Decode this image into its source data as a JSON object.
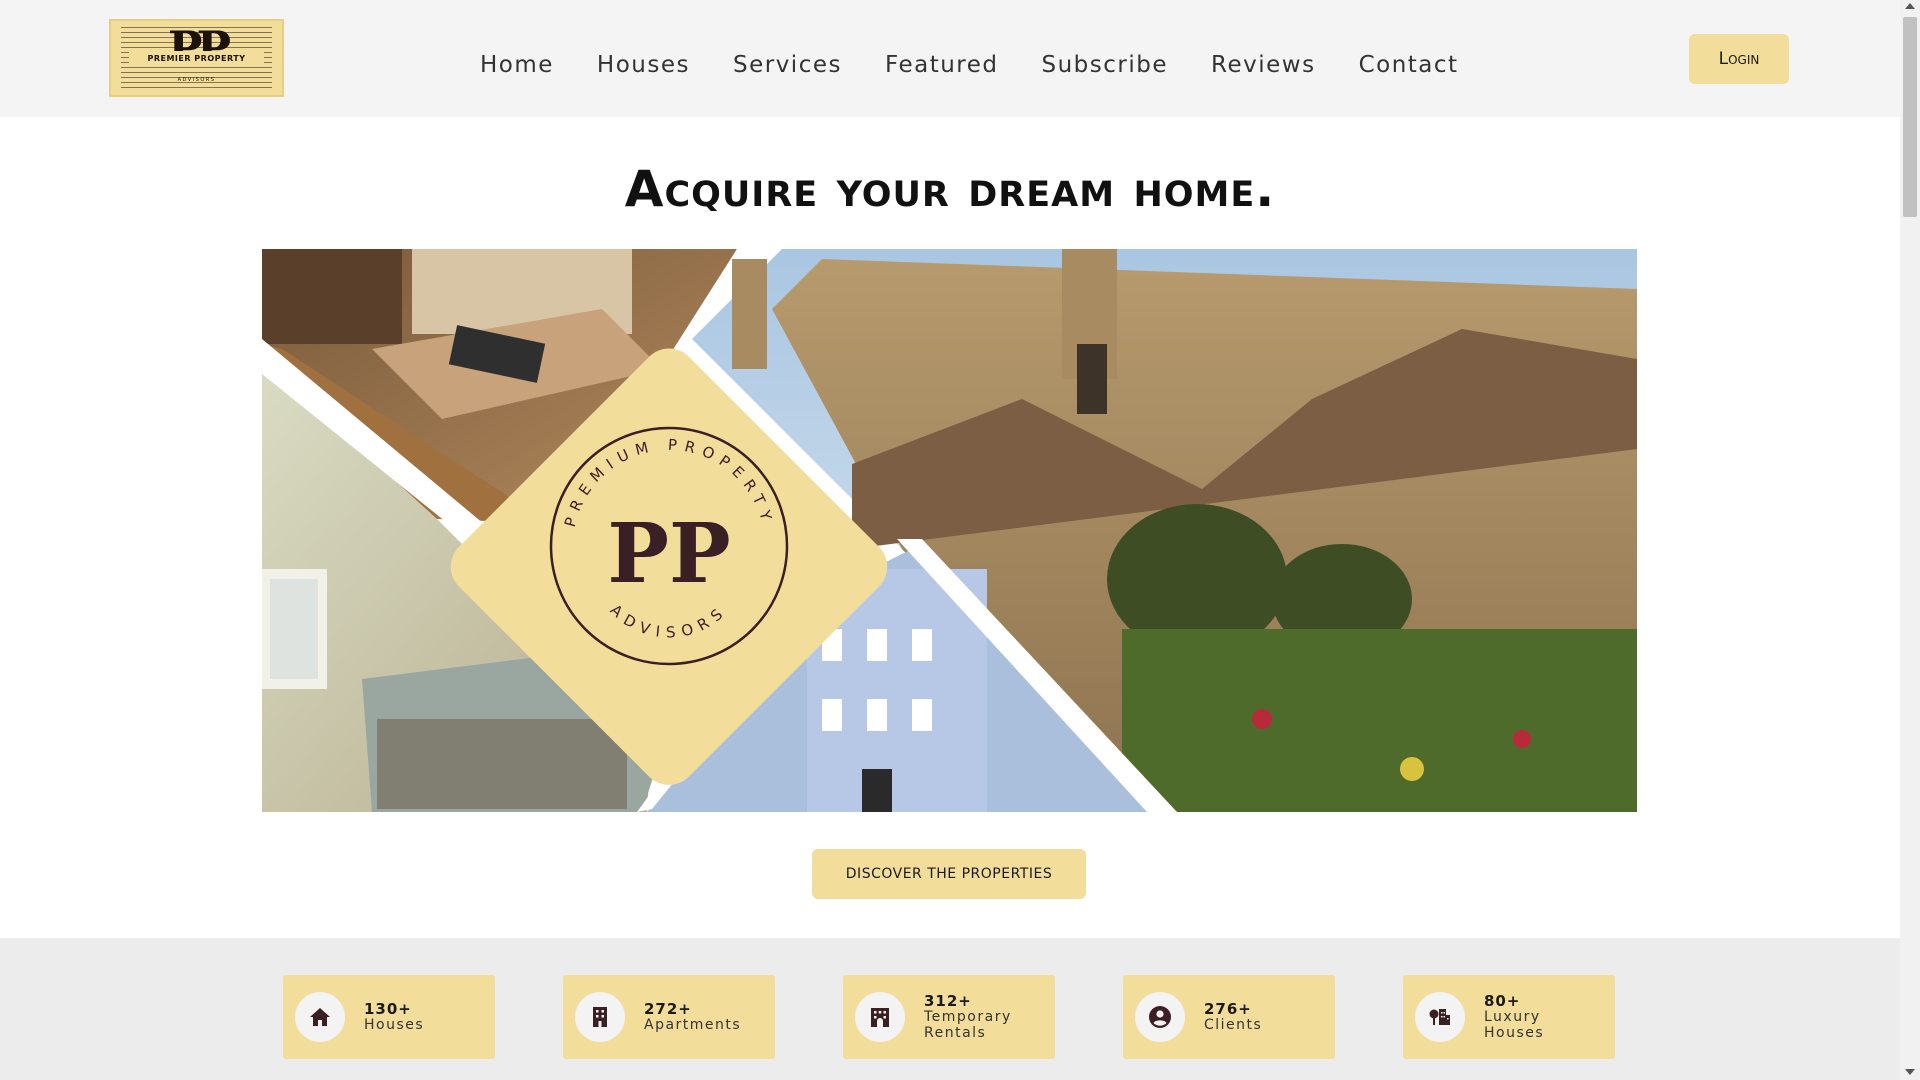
{
  "brand": {
    "logo_mark": "PP",
    "logo_name": "PREMIER PROPERTY",
    "logo_sub": "ADVISORS",
    "accent": "#f2dd9b",
    "dark": "#3a1f24"
  },
  "nav": {
    "items": [
      {
        "label": "Home"
      },
      {
        "label": "Houses"
      },
      {
        "label": "Services"
      },
      {
        "label": "Featured"
      },
      {
        "label": "Subscribe"
      },
      {
        "label": "Reviews"
      },
      {
        "label": "Contact"
      }
    ],
    "login_label": "Login"
  },
  "hero": {
    "title": "Acquire your dream home.",
    "badge_mark": "PP",
    "badge_ring_top": "PREMIUM PROPERTY",
    "badge_ring_bottom": "ADVISORS",
    "cta_label": "DISCOVER THE PROPERTIES"
  },
  "stats": [
    {
      "value": "130+",
      "label": "Houses",
      "icon": "house-icon"
    },
    {
      "value": "272+",
      "label": "Apartments",
      "icon": "apartment-building-icon"
    },
    {
      "value": "312+",
      "label": "Temporary\nRentals",
      "icon": "hotel-building-icon"
    },
    {
      "value": "276+",
      "label": "Clients",
      "icon": "user-circle-icon"
    },
    {
      "value": "80+",
      "label": "Luxury\nHouses",
      "icon": "city-tree-icon"
    }
  ]
}
